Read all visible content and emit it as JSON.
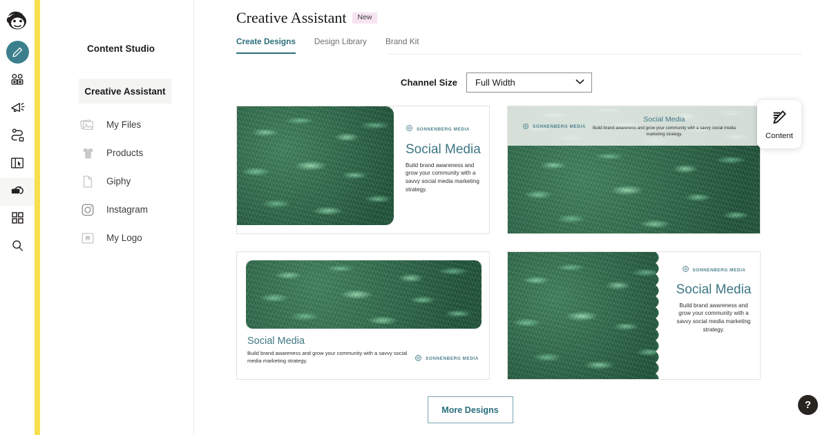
{
  "rail": {
    "logo_icon": "mailchimp-freddie-logo",
    "items": [
      {
        "icon": "pencil-icon",
        "name": "create",
        "active": false,
        "highlight": true
      },
      {
        "icon": "audience-icon",
        "name": "audience",
        "active": false
      },
      {
        "icon": "megaphone-icon",
        "name": "campaigns",
        "active": false
      },
      {
        "icon": "automations-icon",
        "name": "automations",
        "active": false
      },
      {
        "icon": "website-icon",
        "name": "website",
        "active": false
      },
      {
        "icon": "content-studio-icon",
        "name": "content",
        "active": true
      },
      {
        "icon": "apps-grid-icon",
        "name": "integrations",
        "active": false
      },
      {
        "icon": "search-icon",
        "name": "search",
        "active": false
      }
    ]
  },
  "sidebar": {
    "title": "Content Studio",
    "items": [
      {
        "label": "Creative Assistant",
        "icon": "",
        "selected": true
      },
      {
        "label": "My Files",
        "icon": "photos-icon",
        "selected": false
      },
      {
        "label": "Products",
        "icon": "tshirt-icon",
        "selected": false
      },
      {
        "label": "Giphy",
        "icon": "document-icon",
        "selected": false
      },
      {
        "label": "Instagram",
        "icon": "instagram-icon",
        "selected": false
      },
      {
        "label": "My Logo",
        "icon": "logo-frame-icon",
        "selected": false
      }
    ]
  },
  "header": {
    "title": "Creative Assistant",
    "badge": "New",
    "tabs": [
      {
        "label": "Create Designs",
        "active": true
      },
      {
        "label": "Design Library",
        "active": false
      },
      {
        "label": "Brand Kit",
        "active": false
      }
    ]
  },
  "toolbar": {
    "channel_size_label": "Channel Size",
    "channel_size_value": "Full Width",
    "chevron_icon": "chevron-down-icon"
  },
  "brand": {
    "name": "SONNENBERG MEDIA",
    "logo_icon": "sonnenberg-flower-mark"
  },
  "designs": [
    {
      "layout": "image-left-text-right",
      "heading": "Social Media",
      "body": "Build brand awareness and grow your community with a savvy social media marketing strategy.",
      "brand": "SONNENBERG MEDIA"
    },
    {
      "layout": "banner-top-image-bottom",
      "heading": "Social Media",
      "body": "Build brand awareness and grow your community with a savvy social media marketing strategy.",
      "brand": "SONNENBERG MEDIA"
    },
    {
      "layout": "image-top-text-bottom",
      "heading": "Social Media",
      "body": "Build brand awareness and grow your community with a savvy social media marketing strategy.",
      "brand": "SONNENBERG MEDIA"
    },
    {
      "layout": "image-left-scalloped-text-right",
      "heading": "Social Media",
      "body": "Build brand awareness and grow your community with a savvy social media marketing strategy.",
      "brand": "SONNENBERG MEDIA"
    }
  ],
  "actions": {
    "more_designs": "More Designs"
  },
  "floating": {
    "content_label": "Content",
    "content_icon": "pencil-lines-icon",
    "help_label": "?",
    "help_icon": "question-mark-icon"
  },
  "colors": {
    "accent_teal": "#2a6e7c",
    "brand_yellow": "#f7df4d",
    "badge_pink": "#f7e4f3",
    "design_heading": "#3d7683"
  }
}
